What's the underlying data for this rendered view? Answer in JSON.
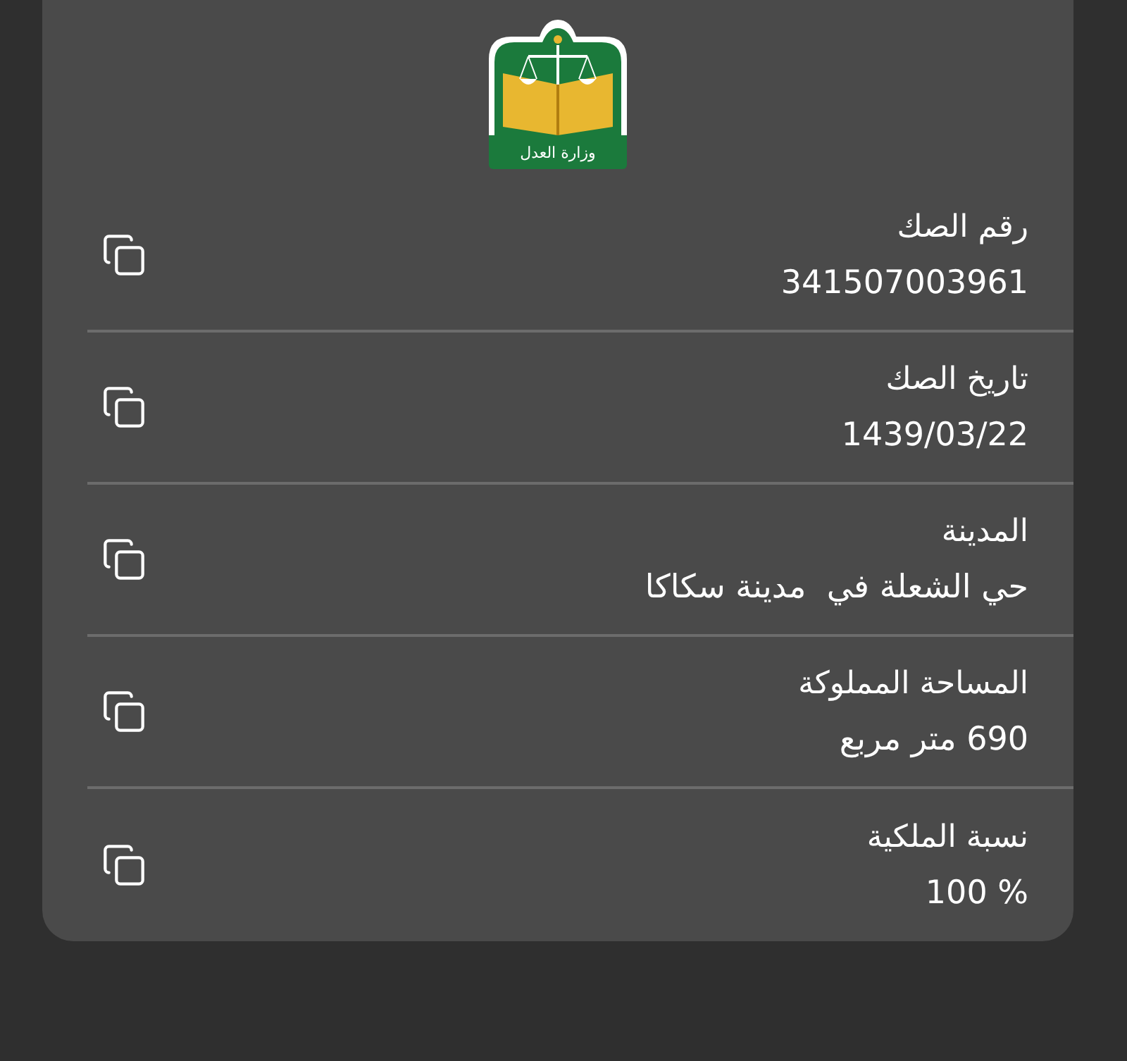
{
  "logo": {
    "text": "وزارة العدل"
  },
  "fields": [
    {
      "label": "رقم الصك",
      "value": "341507003961"
    },
    {
      "label": "تاريخ الصك",
      "value": "1439/03/22"
    },
    {
      "label": "المدينة",
      "value": "حي الشعلة في  مدينة سكاكا"
    },
    {
      "label": "المساحة المملوكة",
      "value": "690 متر مربع"
    },
    {
      "label": "نسبة الملكية",
      "value": "100 %"
    }
  ]
}
